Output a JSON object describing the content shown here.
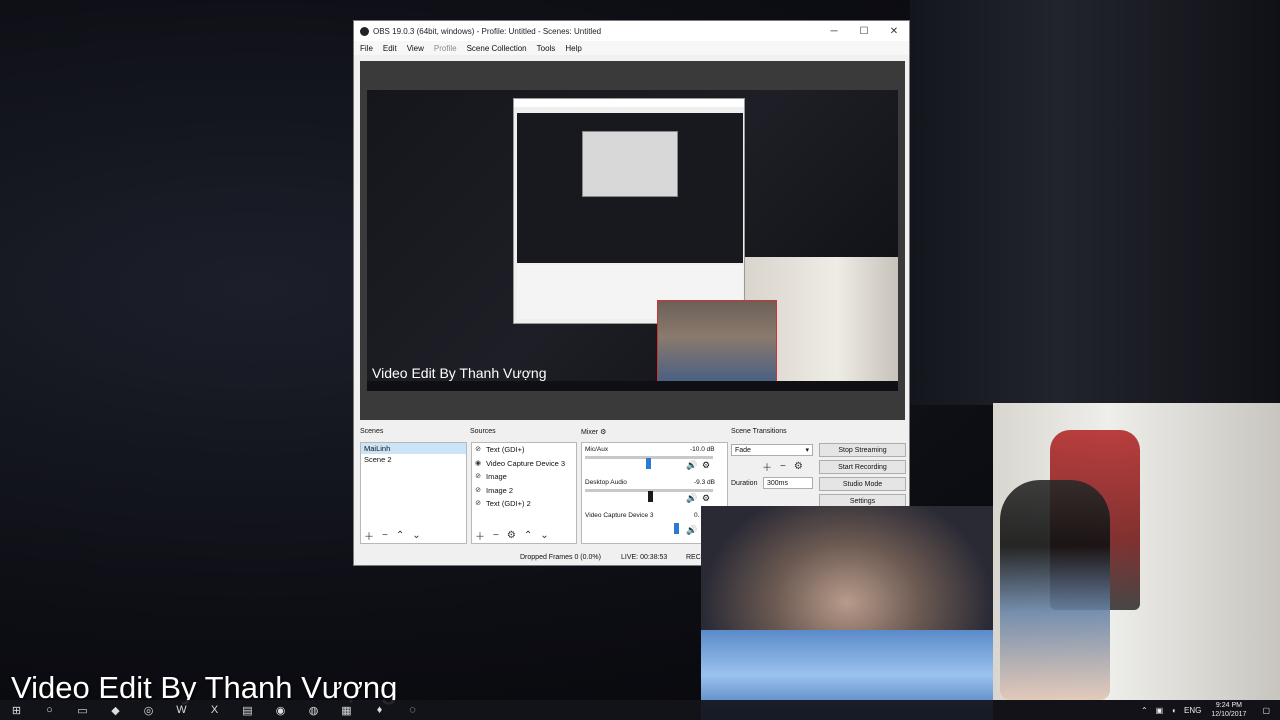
{
  "window": {
    "title": "OBS 19.0.3 (64bit, windows) - Profile: Untitled - Scenes: Untitled",
    "minimize": "─",
    "maximize": "☐",
    "close": "✕"
  },
  "menu": [
    "File",
    "Edit",
    "View",
    "Profile",
    "Scene Collection",
    "Tools",
    "Help"
  ],
  "preview": {
    "overlay_text": "Video Edit By Thanh Vượng"
  },
  "scenes": {
    "label": "Scenes",
    "items": [
      "MaiLinh",
      "Scene 2"
    ]
  },
  "sources": {
    "label": "Sources",
    "items": [
      "Text (GDI+)",
      "Video Capture Device 3",
      "Image",
      "Image 2",
      "Text (GDI+) 2"
    ]
  },
  "mixer": {
    "label": "Mixer",
    "tracks": [
      {
        "name": "Mic/Aux",
        "db": "-10.0 dB"
      },
      {
        "name": "Desktop Audio",
        "db": "-9.3 dB"
      },
      {
        "name": "Video Capture Device 3",
        "db": "0."
      }
    ]
  },
  "transitions": {
    "label": "Scene Transitions",
    "selected": "Fade",
    "duration_label": "Duration",
    "duration_value": "300ms"
  },
  "controls": {
    "stop_streaming": "Stop Streaming",
    "start_recording": "Start Recording",
    "studio_mode": "Studio Mode",
    "settings": "Settings"
  },
  "status": {
    "dropped": "Dropped Frames 0 (0.0%)",
    "live": "LIVE: 00:38:53",
    "rec": "REC"
  },
  "desktop": {
    "watermark": "Video Edit By Thanh Vượng"
  },
  "taskbar": {
    "lang": "ENG",
    "time": "9:24 PM",
    "date": "12/10/2017"
  }
}
